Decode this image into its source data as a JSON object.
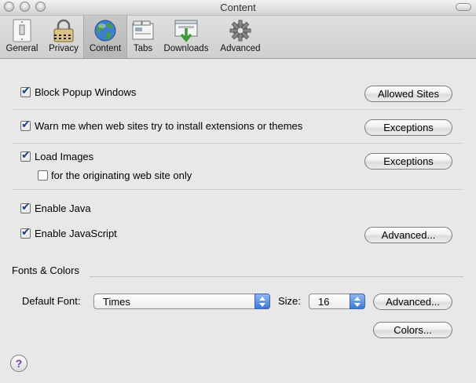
{
  "window": {
    "title": "Content"
  },
  "toolbar": {
    "items": [
      {
        "label": "General",
        "icon": "light-switch-icon"
      },
      {
        "label": "Privacy",
        "icon": "padlock-icon"
      },
      {
        "label": "Content",
        "icon": "globe-icon",
        "selected": true
      },
      {
        "label": "Tabs",
        "icon": "tabs-icon"
      },
      {
        "label": "Downloads",
        "icon": "downloads-icon"
      },
      {
        "label": "Advanced",
        "icon": "gear-icon"
      }
    ]
  },
  "content": {
    "block_popups": {
      "label": "Block Popup Windows",
      "checked": true,
      "button": "Allowed Sites"
    },
    "warn_extensions": {
      "label": "Warn me when web sites try to install extensions or themes",
      "checked": true,
      "button": "Exceptions"
    },
    "load_images": {
      "label": "Load Images",
      "checked": true,
      "button": "Exceptions"
    },
    "originating_only": {
      "label": "for the originating web site only",
      "checked": false
    },
    "enable_java": {
      "label": "Enable Java",
      "checked": true
    },
    "enable_javascript": {
      "label": "Enable JavaScript",
      "checked": true,
      "button": "Advanced..."
    },
    "fonts_colors": {
      "heading": "Fonts & Colors",
      "default_font_label": "Default Font:",
      "default_font_value": "Times",
      "size_label": "Size:",
      "size_value": "16",
      "advanced_button": "Advanced...",
      "colors_button": "Colors..."
    }
  },
  "help": {
    "symbol": "?"
  }
}
